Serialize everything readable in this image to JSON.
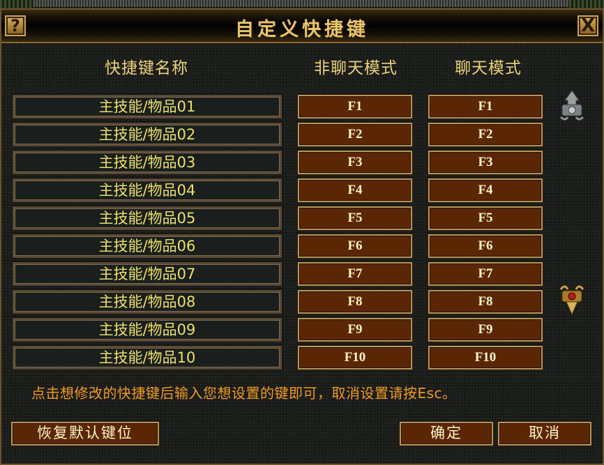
{
  "dialog": {
    "title": "自定义快捷键",
    "help_label": "?",
    "close_label": "X"
  },
  "columns": {
    "name": "快捷键名称",
    "nonchat": "非聊天模式",
    "chat": "聊天模式"
  },
  "rows": [
    {
      "name": "主技能/物品01",
      "nonchat": "F1",
      "chat": "F1"
    },
    {
      "name": "主技能/物品02",
      "nonchat": "F2",
      "chat": "F2"
    },
    {
      "name": "主技能/物品03",
      "nonchat": "F3",
      "chat": "F3"
    },
    {
      "name": "主技能/物品04",
      "nonchat": "F4",
      "chat": "F4"
    },
    {
      "name": "主技能/物品05",
      "nonchat": "F5",
      "chat": "F5"
    },
    {
      "name": "主技能/物品06",
      "nonchat": "F6",
      "chat": "F6"
    },
    {
      "name": "主技能/物品07",
      "nonchat": "F7",
      "chat": "F7"
    },
    {
      "name": "主技能/物品08",
      "nonchat": "F8",
      "chat": "F8"
    },
    {
      "name": "主技能/物品09",
      "nonchat": "F9",
      "chat": "F9"
    },
    {
      "name": "主技能/物品10",
      "nonchat": "F10",
      "chat": "F10"
    }
  ],
  "hint": "点击想修改的快捷键后输入您想设置的键即可，取消设置请按Esc。",
  "buttons": {
    "restore": "恢复默认键位",
    "ok": "确定",
    "cancel": "取消"
  },
  "icons": {
    "scroll_up": "scroll-up-arrow-icon",
    "scroll_down": "scroll-down-arrow-icon"
  },
  "colors": {
    "title": "#e8c46a",
    "header": "#ead17a",
    "name_text": "#ece06a",
    "key_fill": "#5a2604",
    "hint": "#f09a22"
  }
}
